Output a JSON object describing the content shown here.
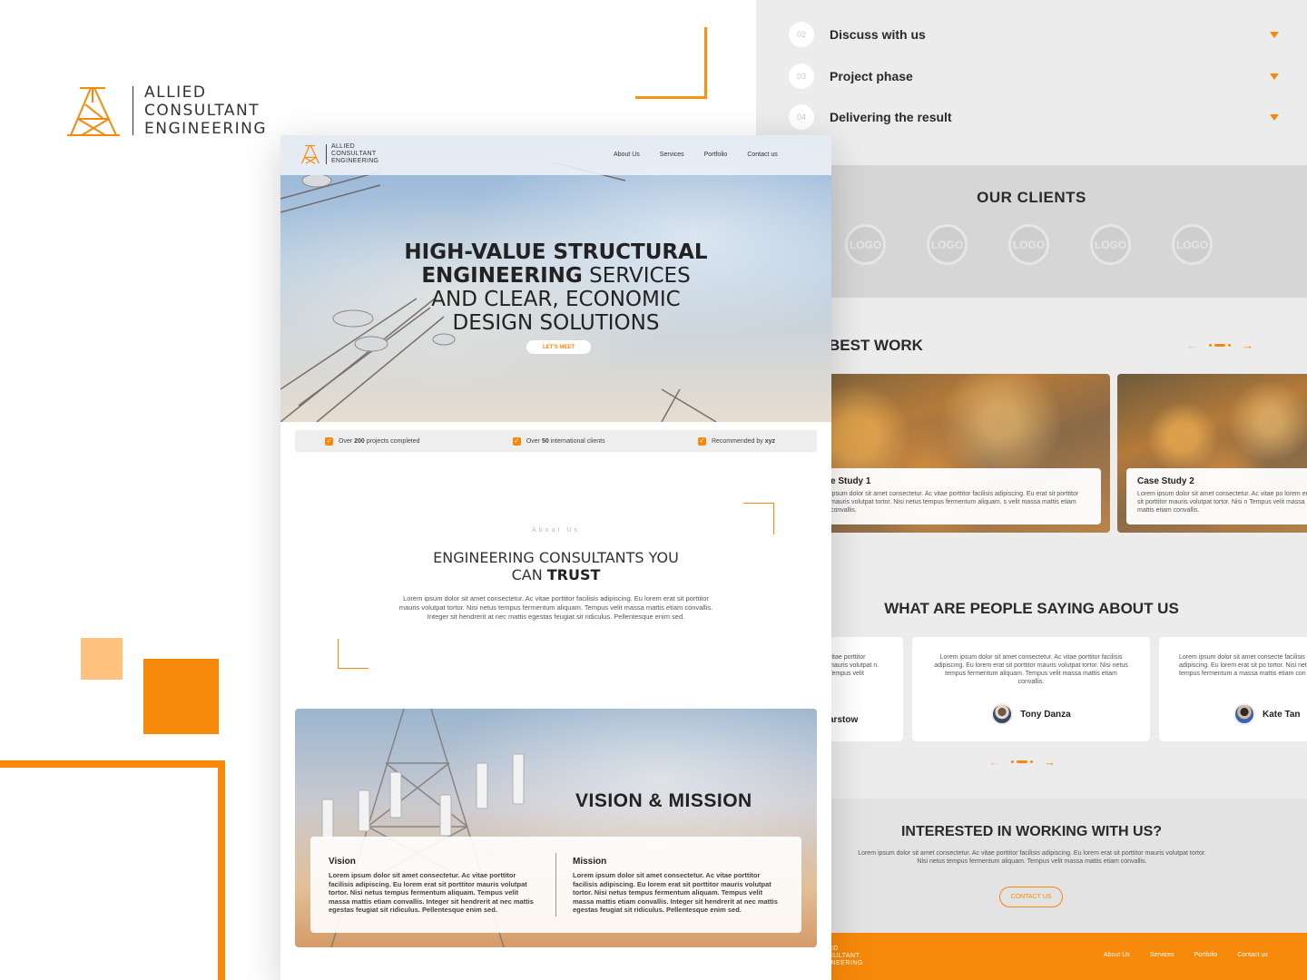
{
  "brand": {
    "line1": "ALLIED",
    "line2": "CONSULTANT",
    "line3": "ENGINEERING"
  },
  "colors": {
    "accent": "#f7890a",
    "accent_light": "#ffc37f",
    "panel": "#ececec"
  },
  "front": {
    "nav": {
      "logo": {
        "line1": "ALLIED",
        "line2": "CONSULTANT",
        "line3": "ENGINEERING"
      },
      "links": [
        "About Us",
        "Services",
        "Portfolio",
        "Contact us"
      ]
    },
    "hero": {
      "title_bold_1": "HIGH-VALUE STRUCTURAL",
      "title_bold_2": "ENGINEERING",
      "title_rest_2": " SERVICES",
      "title_3": "AND CLEAR, ECONOMIC",
      "title_4": "DESIGN SOLUTIONS",
      "button": "LET'S MEET"
    },
    "stats": [
      {
        "pre": "Over ",
        "bold": "200",
        "post": " projects completed"
      },
      {
        "pre": "Over ",
        "bold": "50",
        "post": " international clients"
      },
      {
        "pre": "Recommended by ",
        "bold": "xyz",
        "post": ""
      }
    ],
    "about": {
      "kicker": "About Us",
      "title_1": "ENGINEERING CONSULTANTS YOU",
      "title_2_pre": "CAN ",
      "title_2_bold": "TRUST",
      "text": "Lorem ipsum dolor sit amet consectetur. Ac vitae porttitor facilisis adipiscing. Eu lorem erat sit porttitor mauris volutpat tortor. Nisi netus tempus fermentum aliquam. Tempus velit massa mattis etiam convallis. Integer sit hendrerit at nec mattis egestas feugiat sit ridiculus. Pellentesque enim sed."
    },
    "vision_mission": {
      "title": "VISION & MISSION",
      "vision_heading": "Vision",
      "vision_text": "Lorem ipsum dolor sit amet consectetur. Ac vitae porttitor facilisis adipiscing. Eu lorem erat sit porttitor mauris volutpat tortor. Nisi netus tempus fermentum aliquam. Tempus velit massa mattis etiam convallis. Integer sit hendrerit at nec mattis egestas feugiat sit ridiculus. Pellentesque enim sed.",
      "mission_heading": "Mission",
      "mission_text": "Lorem ipsum dolor sit amet consectetur. Ac vitae porttitor facilisis adipiscing. Eu lorem erat sit porttitor mauris volutpat tortor. Nisi netus tempus fermentum aliquam. Tempus velit massa mattis etiam convallis. Integer sit hendrerit at nec mattis egestas feugiat sit ridiculus. Pellentesque enim sed."
    }
  },
  "back": {
    "steps": [
      {
        "num": "02",
        "label": "Discuss with us"
      },
      {
        "num": "03",
        "label": "Project phase"
      },
      {
        "num": "04",
        "label": "Delivering the result"
      }
    ],
    "clients": {
      "title": "OUR CLIENTS",
      "logo_label": "LOGO"
    },
    "best_work": {
      "title": "BEST WORK",
      "cases": [
        {
          "title": "e Study 1",
          "text": "ipsum dolor sit amet consectetur. Ac vitae porttitor facilisis adipiscing. Eu erat sit porttitor mauris volutpat tortor. Nisi netus tempus fermentum aliquam. s velit massa mattis etiam convallis."
        },
        {
          "title": "Case Study 2",
          "text": "Lorem ipsum dolor sit amet consectetur. Ac vitae po lorem erat sit porttitor mauris volutpat tortor. Nisi n Tempus velit massa mattis etiam convallis."
        }
      ]
    },
    "testimonials": {
      "title": "WHAT ARE PEOPLE SAYING ABOUT US",
      "cards": [
        {
          "text": "vitae porttitor mauris volutpat n. Tempus velit",
          "name": "arstow"
        },
        {
          "text": "Lorem ipsum dolor sit amet consectetur. Ac vitae porttitor facilisis adipiscing. Eu lorem erat sit porttitor mauris volutpat tortor. Nisi netus tempus fermentum aliquam. Tempus velit massa mattis etiam convallis.",
          "name": "Tony Danza"
        },
        {
          "text": "Lorem ipsum dolor sit amet consecte facilisis adipiscing. Eu lorem erat sit po tortor. Nisi netus tempus fermentum a massa mattis etiam con",
          "name": "Kate Tan"
        }
      ]
    },
    "interest": {
      "title": "INTERESTED IN WORKING WITH US?",
      "text": "Lorem ipsum dolor sit amet consectetur. Ac vitae porttitor facilisis adipiscing. Eu lorem erat sit porttitor mauris volutpat tortor. Nisi netus tempus fermentum aliquam. Tempus velit massa mattis etiam convallis.",
      "button": "CONTACT US"
    },
    "footer": {
      "brand_1": "ED",
      "brand_2": "SULTANT",
      "brand_3": "INEERING",
      "links": [
        "About Us",
        "Services",
        "Portfolio",
        "Contact us"
      ]
    }
  }
}
